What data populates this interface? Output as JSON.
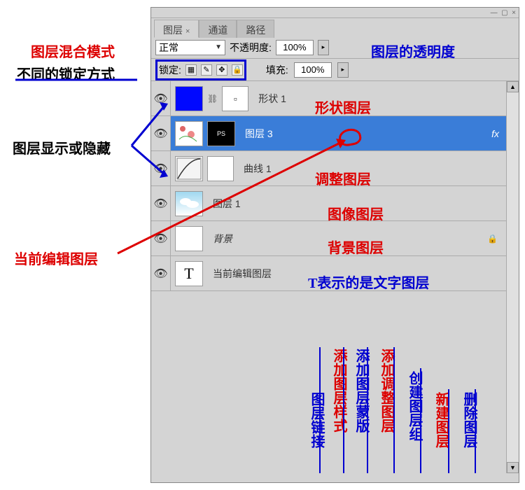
{
  "tabs": {
    "layers": "图层",
    "channels": "通道",
    "paths": "路径"
  },
  "blend_mode": "正常",
  "opacity_label": "不透明度:",
  "opacity_value": "100%",
  "lock_label": "锁定:",
  "fill_label": "填充:",
  "fill_value": "100%",
  "layers_list": [
    {
      "name": "形状 1",
      "type": "shape"
    },
    {
      "name": "图层 3",
      "type": "selected"
    },
    {
      "name": "曲线 1",
      "type": "adjust"
    },
    {
      "name": "图层 1",
      "type": "image"
    },
    {
      "name": "背景",
      "type": "bg"
    },
    {
      "name": "当前编辑图层",
      "type": "text"
    }
  ],
  "fx_label": "fx",
  "ps_label": "PS",
  "annotations": {
    "blend_mode": "图层混合模式",
    "opacity": "图层的透明度",
    "lock_methods": "不同的锁定方式",
    "visibility": "图层显示或隐藏",
    "current_edit": "当前编辑图层",
    "shape_layer": "形状图层",
    "adjust_layer": "调整图层",
    "image_layer": "图像图层",
    "bg_layer": "背景图层",
    "text_layer": "T表示的是文字图层"
  },
  "bottom_labels": {
    "link": "图层链接",
    "style": "添加图层样式",
    "mask": "添加图层蒙版",
    "adjust": "添加调整图层",
    "group": "创建图层组",
    "new": "新建图层",
    "delete": "删除图层"
  }
}
